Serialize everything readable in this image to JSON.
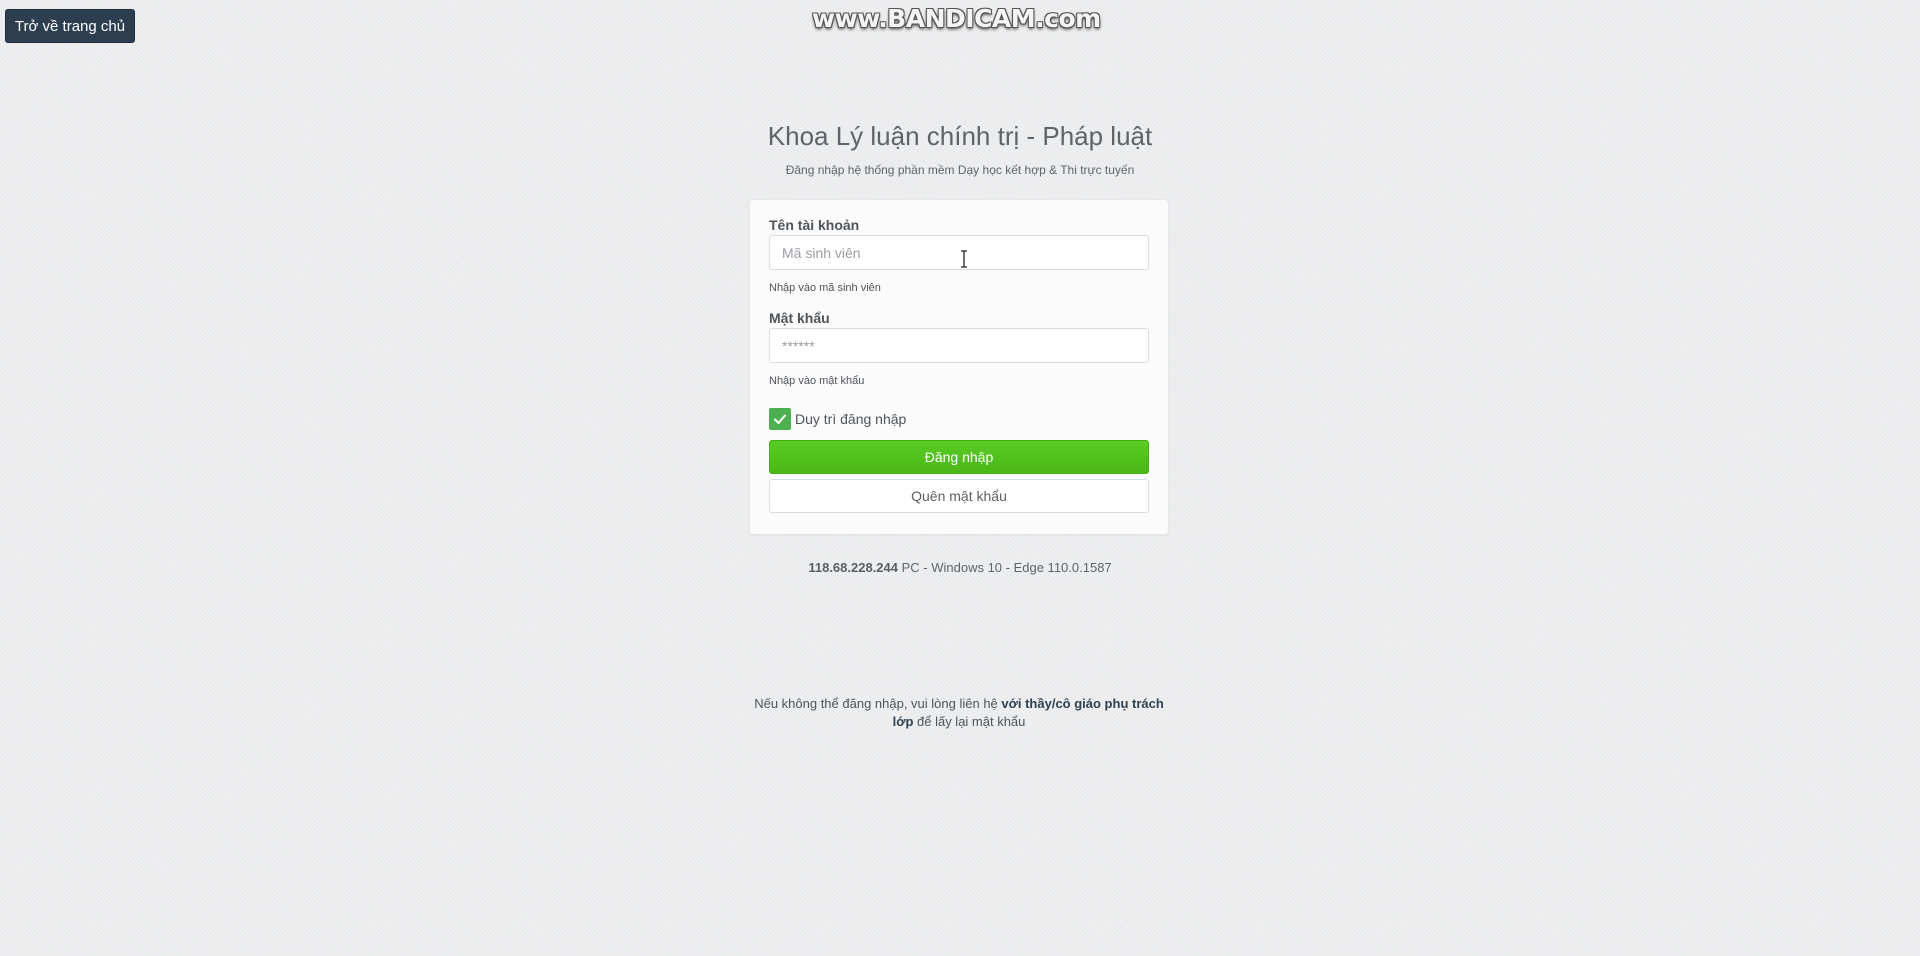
{
  "home_button": {
    "label": "Trở về trang chủ"
  },
  "watermark": {
    "text": "www.BANDICAM.com"
  },
  "header": {
    "title": "Khoa Lý luận chính trị - Pháp luật",
    "subtitle": "Đăng nhập hệ thống phần mềm Dạy học kết hợp & Thi trực tuyến"
  },
  "login_form": {
    "username": {
      "label": "Tên tài khoản",
      "placeholder": "Mã sinh viên",
      "value": "",
      "help": "Nhập vào mã sinh viên"
    },
    "password": {
      "label": "Mật khẩu",
      "placeholder": "******",
      "value": "",
      "help": "Nhập vào mật khẩu"
    },
    "remember": {
      "label": "Duy trì đăng nhập",
      "checked": true
    },
    "submit_label": "Đăng nhập",
    "forgot_label": "Quên mật khẩu"
  },
  "client_info": {
    "ip": "118.68.228.244",
    "details": " PC - Windows 10 - Edge 110.0.1587"
  },
  "footer": {
    "prefix": "Nếu không thể đăng nhập, vui lòng liên hệ ",
    "highlight": "với thầy/cô giáo phụ trách lớp",
    "suffix": " để lấy lại mật khẩu"
  },
  "colors": {
    "primary_button": "#52c41a",
    "home_button": "#2c3e50",
    "checkbox": "#4caf50",
    "background": "#eff0f1"
  },
  "icons": {
    "checkbox": "check-icon",
    "cursor": "text-cursor-icon"
  }
}
